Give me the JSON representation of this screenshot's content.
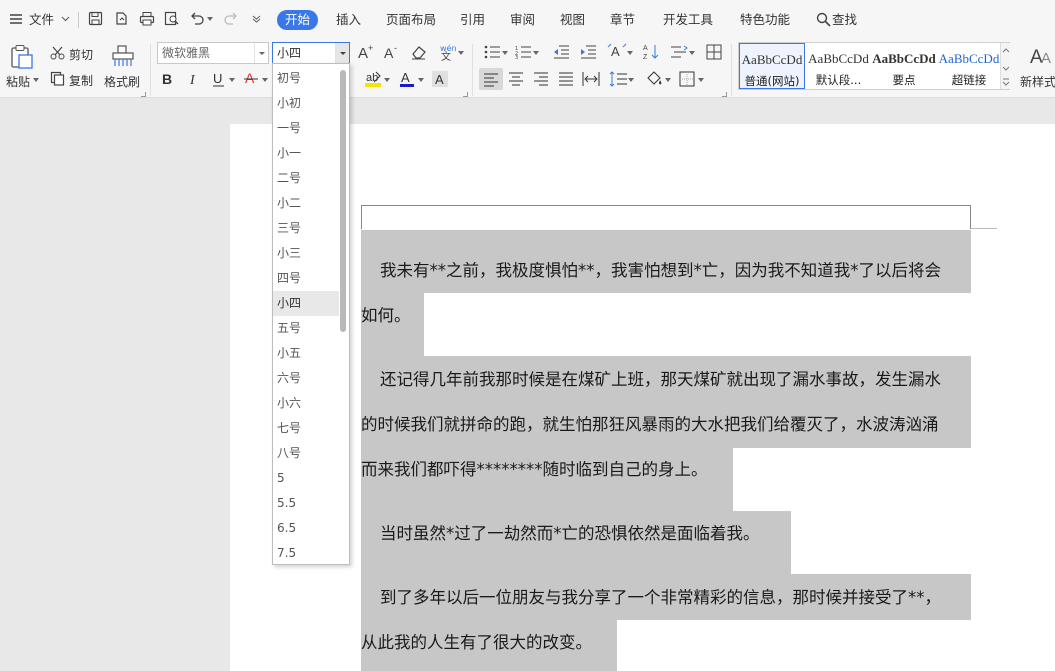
{
  "menubar": {
    "file": "文件",
    "tabs": [
      "开始",
      "插入",
      "页面布局",
      "引用",
      "审阅",
      "视图",
      "章节",
      "开发工具",
      "特色功能"
    ],
    "search": "查找"
  },
  "ribbon": {
    "paste": "粘贴",
    "cut": "剪切",
    "copy": "复制",
    "format_painter": "格式刷",
    "font_name": "微软雅黑",
    "font_size": "小四",
    "styles": [
      {
        "sample": "AaBbCcDd",
        "name": "普通(网站)"
      },
      {
        "sample": "AaBbCcDd",
        "name": "默认段..."
      },
      {
        "sample": "AaBbCcDd",
        "name": "要点"
      },
      {
        "sample": "AaBbCcDd",
        "name": "超链接"
      }
    ],
    "new_style": "新样式"
  },
  "font_size_dropdown": {
    "options": [
      "初号",
      "小初",
      "一号",
      "小一",
      "二号",
      "小二",
      "三号",
      "小三",
      "四号",
      "小四",
      "五号",
      "小五",
      "六号",
      "小六",
      "七号",
      "八号",
      "5",
      "5.5",
      "6.5",
      "7.5"
    ],
    "selected": "小四"
  },
  "document": {
    "lines": [
      "我未有**之前，我极度惧怕**，我害怕想到*亡，因为我不知道我*了以后将会",
      "如何。",
      "还记得几年前我那时候是在煤矿上班，那天煤矿就出现了漏水事故，发生漏水",
      "的时候我们就拼命的跑，就生怕那狂风暴雨的大水把我们给覆灭了，水波涛汹涌",
      "而来我们都吓得********随时临到自己的身上。",
      "当时虽然*过了一劫然而*亡的恐惧依然是面临着我。",
      "到了多年以后一位朋友与我分享了一个非常精彩的信息，那时候并接受了**，",
      "从此我的人生有了很大的改变。"
    ]
  },
  "colors": {
    "accent": "#3a78e8",
    "highlight": "#c7c7c7",
    "font_color_red": "#e03030",
    "highlight_yellow": "#f5e400",
    "font_color_blue": "#1a1ad0"
  }
}
